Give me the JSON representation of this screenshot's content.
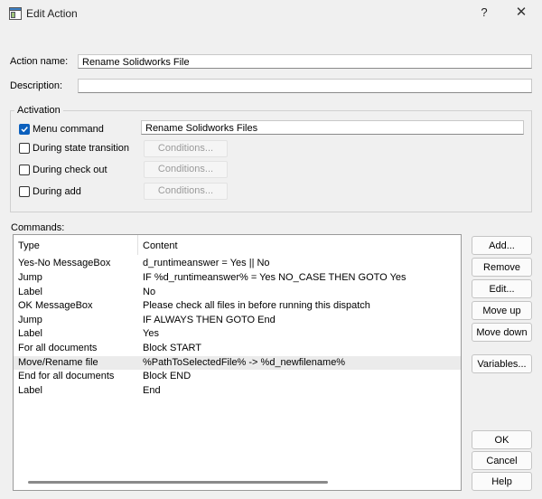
{
  "window": {
    "title": "Edit Action",
    "help_glyph": "?",
    "close_glyph": "✕"
  },
  "action_name": {
    "label": "Action name:",
    "value": "Rename Solidworks File"
  },
  "description": {
    "label": "Description:",
    "value": ""
  },
  "activation": {
    "legend": "Activation",
    "menu_command": {
      "label": "Menu command",
      "checked": true,
      "value": "Rename Solidworks Files"
    },
    "state_transition": {
      "label": "During state transition",
      "checked": false,
      "button": "Conditions..."
    },
    "check_out": {
      "label": "During check out",
      "checked": false,
      "button": "Conditions..."
    },
    "add": {
      "label": "During add",
      "checked": false,
      "button": "Conditions..."
    }
  },
  "commands": {
    "label": "Commands:",
    "columns": [
      "Type",
      "Content"
    ],
    "rows": [
      {
        "type": "Yes-No MessageBox",
        "content": "d_runtimeanswer = Yes || No"
      },
      {
        "type": "Jump",
        "content": "IF %d_runtimeanswer% = Yes NO_CASE THEN GOTO Yes"
      },
      {
        "type": "Label",
        "content": "No"
      },
      {
        "type": "OK MessageBox",
        "content": "Please check all files in before running this dispatch"
      },
      {
        "type": "Jump",
        "content": "IF  ALWAYS  THEN GOTO End"
      },
      {
        "type": "Label",
        "content": "Yes"
      },
      {
        "type": "For all documents",
        "content": "Block START"
      },
      {
        "type": "Move/Rename file",
        "content": "%PathToSelectedFile% -> %d_newfilename%"
      },
      {
        "type": "End for all documents",
        "content": "Block END"
      },
      {
        "type": "Label",
        "content": "End"
      }
    ],
    "selected_index": 7
  },
  "side_buttons": {
    "add": "Add...",
    "remove": "Remove",
    "edit": "Edit...",
    "move_up": "Move up",
    "move_down": "Move down",
    "variables": "Variables..."
  },
  "dialog_buttons": {
    "ok": "OK",
    "cancel": "Cancel",
    "help": "Help"
  },
  "colors": {
    "accent": "#0a5fbd",
    "selection": "#ebebeb",
    "background": "#f0f0f0"
  }
}
